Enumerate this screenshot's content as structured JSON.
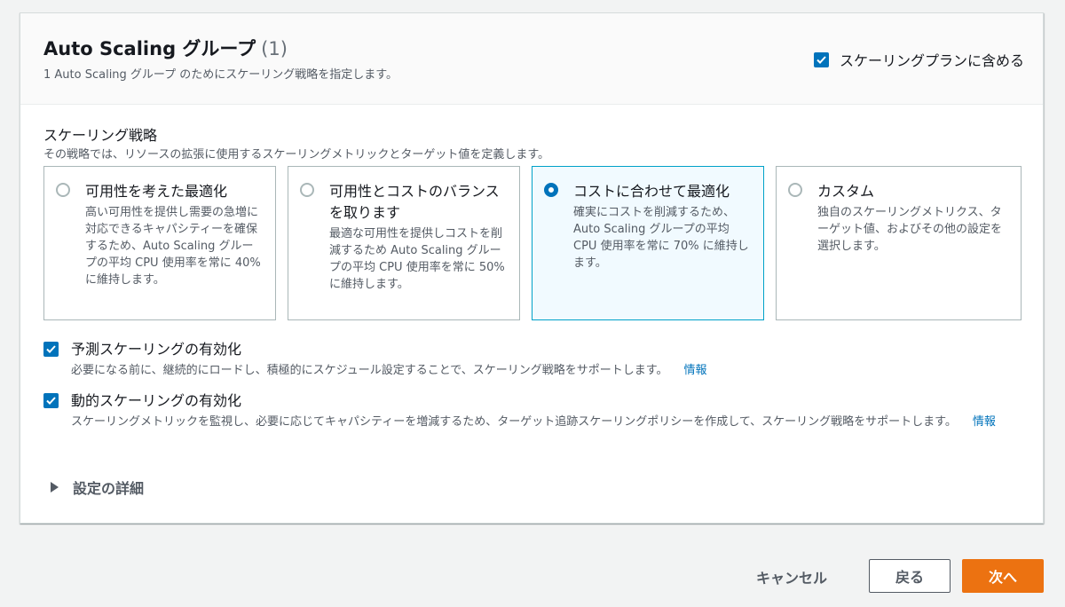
{
  "header": {
    "title": "Auto Scaling グループ",
    "count": "(1)",
    "subtitle": "1 Auto Scaling グループ のためにスケーリング戦略を指定します。",
    "include_in_plan": {
      "label": "スケーリングプランに含める",
      "checked": true
    }
  },
  "strategy": {
    "label": "スケーリング戦略",
    "description": "その戦略では、リソースの拡張に使用するスケーリングメトリックとターゲット値を定義します。",
    "options": [
      {
        "title": "可用性を考えた最適化",
        "description": "高い可用性を提供し需要の急増に対応できるキャパシティーを確保するため、Auto Scaling グループの平均 CPU 使用率を常に 40% に維持します。",
        "selected": false
      },
      {
        "title": "可用性とコストのバランスを取ります",
        "description": "最適な可用性を提供しコストを削減するため Auto Scaling グループの平均 CPU 使用率を常に 50% に維持します。",
        "selected": false
      },
      {
        "title": "コストに合わせて最適化",
        "description": "確実にコストを削減するため、 Auto Scaling グループの平均 CPU 使用率を常に 70% に維持します。",
        "selected": true
      },
      {
        "title": "カスタム",
        "description": "独自のスケーリングメトリクス、ターゲット値、およびその他の設定を選択します。",
        "selected": false
      }
    ]
  },
  "predictive": {
    "label": "予測スケーリングの有効化",
    "description": "必要になる前に、継続的にロードし、積極的にスケジュール設定することで、スケーリング戦略をサポートします。",
    "info": "情報",
    "checked": true
  },
  "dynamic": {
    "label": "動的スケーリングの有効化",
    "description": "スケーリングメトリックを監視し、必要に応じてキャパシティーを増減するため、ターゲット追跡スケーリングポリシーを作成して、スケーリング戦略をサポートします。",
    "info": "情報",
    "checked": true
  },
  "details": {
    "label": "設定の詳細",
    "expanded": false
  },
  "footer": {
    "cancel": "キャンセル",
    "back": "戻る",
    "next": "次へ"
  },
  "colors": {
    "accent": "#0073bb",
    "primary_button": "#ec7211",
    "selected_card_bg": "#f1faff",
    "selected_card_border": "#00a1c9"
  }
}
